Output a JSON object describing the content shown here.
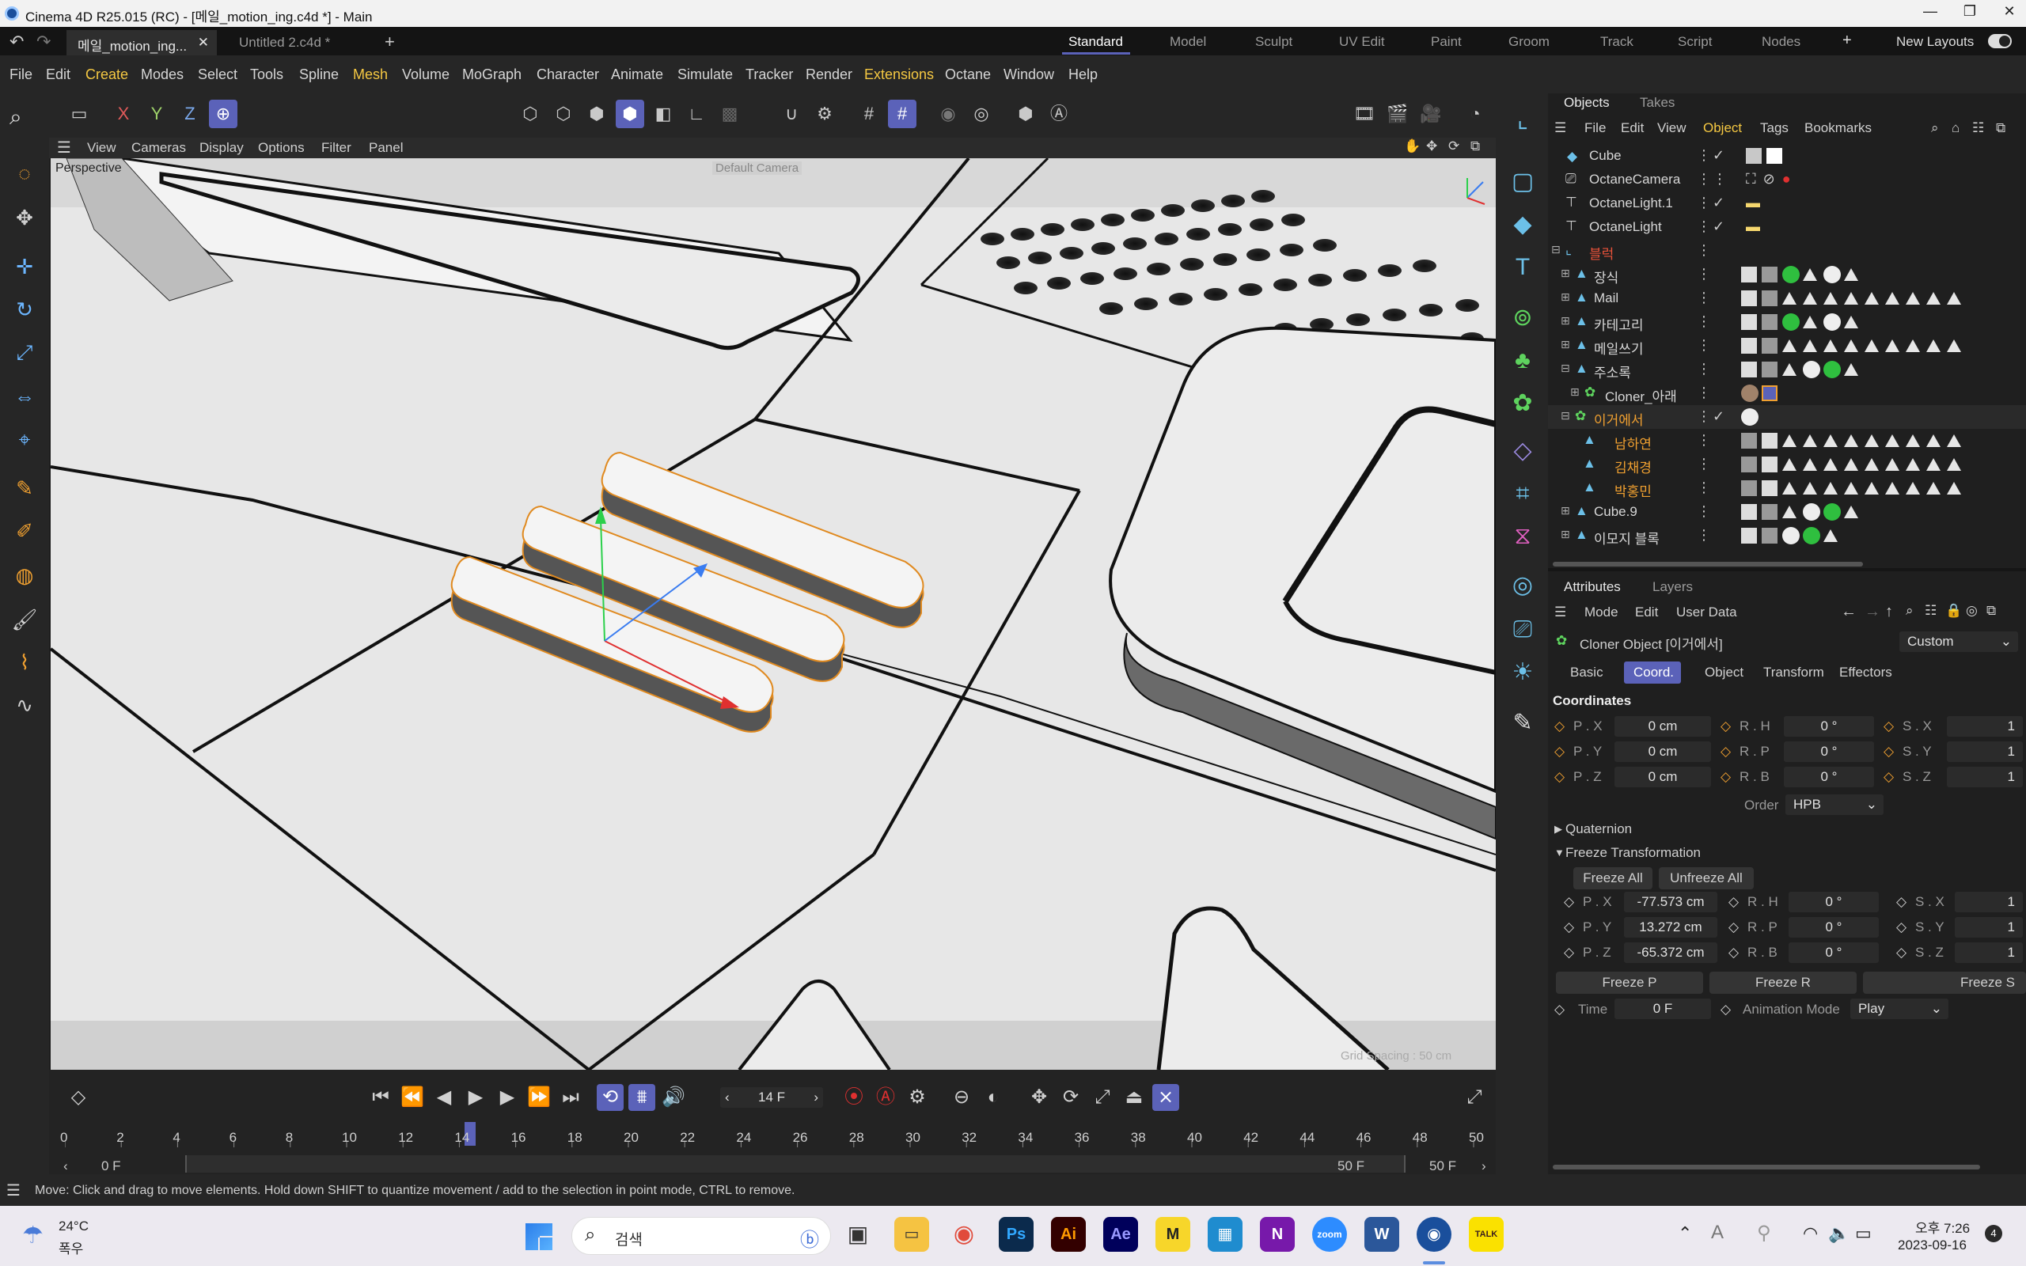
{
  "window": {
    "title": "Cinema 4D R25.015 (RC) - [메일_motion_ing.c4d *] - Main",
    "minimize": "—",
    "maximize": "❐",
    "close": "✕"
  },
  "tabs": {
    "doc1": "메일_motion_ing...",
    "doc1_close": "✕",
    "doc2": "Untitled 2.c4d *",
    "add": "+"
  },
  "layouts": {
    "items": [
      "Standard",
      "Model",
      "Sculpt",
      "UV Edit",
      "Paint",
      "Groom",
      "Track",
      "Script",
      "Nodes"
    ],
    "add": "+",
    "new_layouts": "New Layouts"
  },
  "menu": [
    "File",
    "Edit",
    "Create",
    "Modes",
    "Select",
    "Tools",
    "Spline",
    "Mesh",
    "Volume",
    "MoGraph",
    "Character",
    "Animate",
    "Simulate",
    "Tracker",
    "Render",
    "Extensions",
    "Octane",
    "Window",
    "Help"
  ],
  "toolbar": {
    "x": "X",
    "y": "Y",
    "z": "Z"
  },
  "viewport_menu": [
    "View",
    "Cameras",
    "Display",
    "Options",
    "Filter",
    "Panel"
  ],
  "viewport": {
    "label": "Perspective",
    "camera": "Default Camera",
    "grid_spacing": "Grid Spacing : 50 cm"
  },
  "objects_panel": {
    "tabs": [
      "Objects",
      "Takes"
    ],
    "menu": [
      "File",
      "Edit",
      "View",
      "Object",
      "Tags",
      "Bookmarks"
    ],
    "rows": [
      {
        "name": "Cube",
        "color": "#d7d7d7"
      },
      {
        "name": "OctaneCamera",
        "color": "#d7d7d7"
      },
      {
        "name": "OctaneLight.1",
        "color": "#d7d7d7"
      },
      {
        "name": "OctaneLight",
        "color": "#d7d7d7"
      },
      {
        "name": "블럭",
        "color": "#e8523a"
      },
      {
        "name": "장식",
        "color": "#d7d7d7"
      },
      {
        "name": "Mail",
        "color": "#d7d7d7"
      },
      {
        "name": "카테고리",
        "color": "#d7d7d7"
      },
      {
        "name": "메일쓰기",
        "color": "#d7d7d7"
      },
      {
        "name": "주소록",
        "color": "#d7d7d7"
      },
      {
        "name": "Cloner_아래",
        "color": "#d7d7d7"
      },
      {
        "name": "이거에서",
        "color": "#f0a030"
      },
      {
        "name": "남하연",
        "color": "#f0a030"
      },
      {
        "name": "김채경",
        "color": "#f0a030"
      },
      {
        "name": "박홍민",
        "color": "#f0a030"
      },
      {
        "name": "Cube.9",
        "color": "#d7d7d7"
      },
      {
        "name": "이모지 블록",
        "color": "#d7d7d7"
      }
    ]
  },
  "attributes": {
    "tabs": [
      "Attributes",
      "Layers"
    ],
    "menu": [
      "Mode",
      "Edit",
      "User Data"
    ],
    "object_title": "Cloner Object [이거에서]",
    "preset": "Custom",
    "subtabs": [
      "Basic",
      "Coord.",
      "Object",
      "Transform",
      "Effectors"
    ],
    "section": "Coordinates",
    "coords": [
      {
        "p_label": "P . X",
        "p": "0 cm",
        "r_label": "R . H",
        "r": "0 °",
        "s_label": "S . X",
        "s": "1"
      },
      {
        "p_label": "P . Y",
        "p": "0 cm",
        "r_label": "R . P",
        "r": "0 °",
        "s_label": "S . Y",
        "s": "1"
      },
      {
        "p_label": "P . Z",
        "p": "0 cm",
        "r_label": "R . B",
        "r": "0 °",
        "s_label": "S . Z",
        "s": "1"
      }
    ],
    "order_label": "Order",
    "order_value": "HPB",
    "quaternion": "Quaternion",
    "freeze": "Freeze Transformation",
    "freeze_all": "Freeze All",
    "unfreeze_all": "Unfreeze All",
    "frozen": [
      {
        "p_label": "P . X",
        "p": "-77.573 cm",
        "r_label": "R . H",
        "r": "0 °",
        "s_label": "S . X",
        "s": "1"
      },
      {
        "p_label": "P . Y",
        "p": "13.272 cm",
        "r_label": "R . P",
        "r": "0 °",
        "s_label": "S . Y",
        "s": "1"
      },
      {
        "p_label": "P . Z",
        "p": "-65.372 cm",
        "r_label": "R . B",
        "r": "0 °",
        "s_label": "S . Z",
        "s": "1"
      }
    ],
    "freeze_p": "Freeze P",
    "freeze_r": "Freeze R",
    "freeze_s": "Freeze S",
    "time_label": "Time",
    "time_value": "0 F",
    "anim_label": "Animation Mode",
    "anim_value": "Play"
  },
  "timeline": {
    "current_frame": "14 F",
    "ticks": [
      "0",
      "2",
      "4",
      "6",
      "8",
      "10",
      "12",
      "14",
      "16",
      "18",
      "20",
      "22",
      "24",
      "26",
      "28",
      "30",
      "32",
      "34",
      "36",
      "38",
      "40",
      "42",
      "44",
      "46",
      "48",
      "50"
    ],
    "start": "0 F",
    "range_start": "0 F",
    "range_end": "50 F",
    "end": "50 F"
  },
  "status": "Move: Click and drag to move elements. Hold down SHIFT to quantize movement / add to the selection in point mode, CTRL to remove.",
  "taskbar": {
    "temp": "24°C",
    "weather": "폭우",
    "search": "검색",
    "time": "오후 7:26",
    "date": "2023-09-16",
    "notif": "4",
    "apps": [
      "Ps",
      "Ai",
      "Ae",
      "M",
      "N",
      "W",
      "TALK"
    ]
  }
}
